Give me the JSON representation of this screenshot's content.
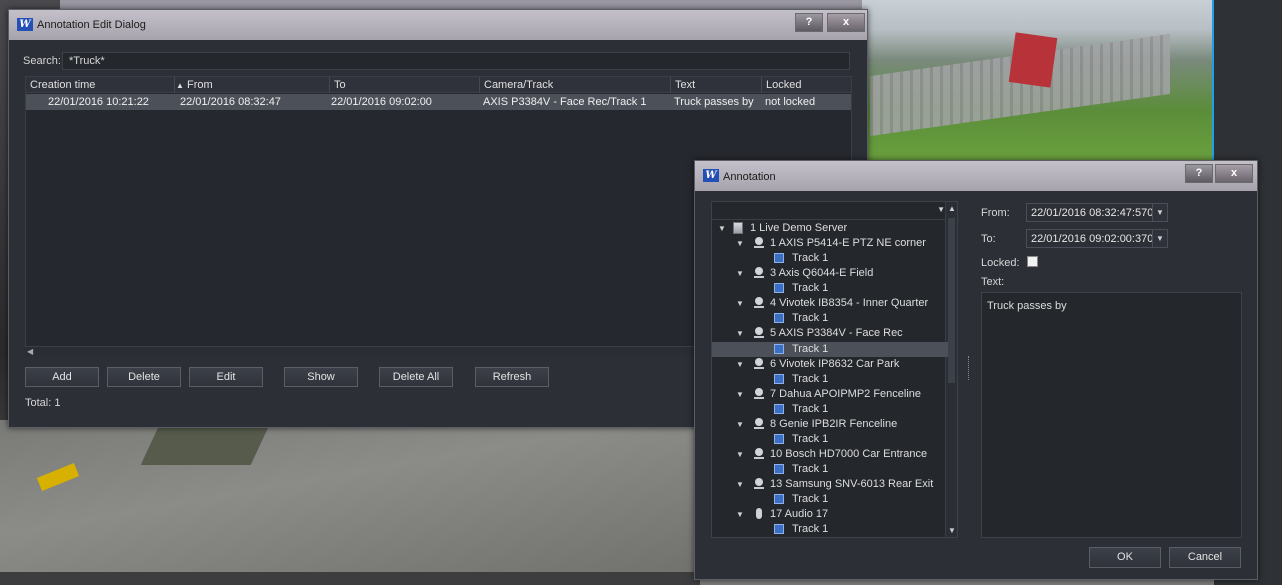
{
  "edit_dialog": {
    "title": "Annotation Edit Dialog",
    "search_label": "Search:",
    "search_value": "*Truck*",
    "columns": [
      "Creation time",
      "From",
      "To",
      "Camera/Track",
      "Text",
      "Locked"
    ],
    "rows": [
      {
        "creation_time": "22/01/2016 10:21:22",
        "from": "22/01/2016 08:32:47",
        "to": "22/01/2016 09:02:00",
        "camera_track": "AXIS P3384V - Face Rec/Track 1",
        "text": "Truck passes by",
        "locked": "not locked"
      }
    ],
    "buttons": {
      "add": "Add",
      "delete": "Delete",
      "edit": "Edit",
      "show": "Show",
      "delete_all": "Delete All",
      "refresh": "Refresh"
    },
    "total": "Total:  1",
    "help": "?",
    "close": "x"
  },
  "annotation_dialog": {
    "title": "Annotation",
    "help": "?",
    "close": "x",
    "from_label": "From:",
    "from_value": "22/01/2016 08:32:47:570",
    "to_label": "To:",
    "to_value": "22/01/2016 09:02:00:370",
    "locked_label": "Locked:",
    "text_label": "Text:",
    "text_value": "Truck passes by",
    "ok": "OK",
    "cancel": "Cancel",
    "tree": {
      "server": "1 Live Demo Server",
      "track_label": "Track 1",
      "cameras": [
        "1 AXIS P5414-E PTZ NE corner",
        "3 Axis Q6044-E Field",
        "4 Vivotek IB8354 - Inner Quarter",
        "5 AXIS P3384V - Face Rec",
        "6 Vivotek IP8632 Car Park",
        "7 Dahua APOIPMP2 Fenceline",
        "8 Genie IPB2IR Fenceline",
        "10 Bosch HD7000 Car Entrance",
        "13 Samsung SNV-6013 Rear Exit",
        "17 Audio 17"
      ]
    }
  },
  "colors": {
    "dialog_bg": "#2c2f36",
    "selected_row": "#4c5058",
    "accent_blue": "#1ea0e8"
  }
}
